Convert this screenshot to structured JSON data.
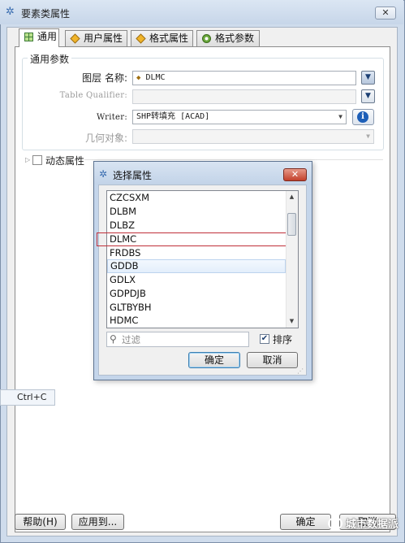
{
  "window": {
    "title": "要素类属性",
    "close_glyph": "✕"
  },
  "tabs": [
    {
      "label": "通用",
      "icon": "grid-icon",
      "active": true
    },
    {
      "label": "用户属性",
      "icon": "diamond-icon"
    },
    {
      "label": "格式属性",
      "icon": "diamond-icon"
    },
    {
      "label": "格式参数",
      "icon": "gear-icon"
    }
  ],
  "general": {
    "group_label": "通用参数",
    "name_label": "图层 名称:",
    "name_value": "DLMC",
    "table_qualifier_label": "Table Qualifier:",
    "writer_label": "Writer:",
    "writer_value": "SHP转填充 [ACAD]",
    "geometry_label": "几何对象:"
  },
  "dynamic": {
    "label": "动态属性"
  },
  "tooltip": {
    "text": "Ctrl+C"
  },
  "buttons": {
    "help": "帮助(H)",
    "apply_to": "应用到...",
    "ok": "确定",
    "cancel": "取消"
  },
  "watermark": {
    "text": "城市数据派"
  },
  "dialog": {
    "title": "选择属性",
    "items": [
      "CZCSXM",
      "DLBM",
      "DLBZ",
      "DLMC",
      "FRDBS",
      "GDDB",
      "GDLX",
      "GDPDJB",
      "GLTBYBH",
      "HDMC"
    ],
    "focused_item": "DLMC",
    "hovered_item": "GDDB",
    "filter_placeholder": "过滤",
    "sort_label": "排序",
    "sort_checked": true,
    "ok": "确定",
    "cancel": "取消"
  }
}
